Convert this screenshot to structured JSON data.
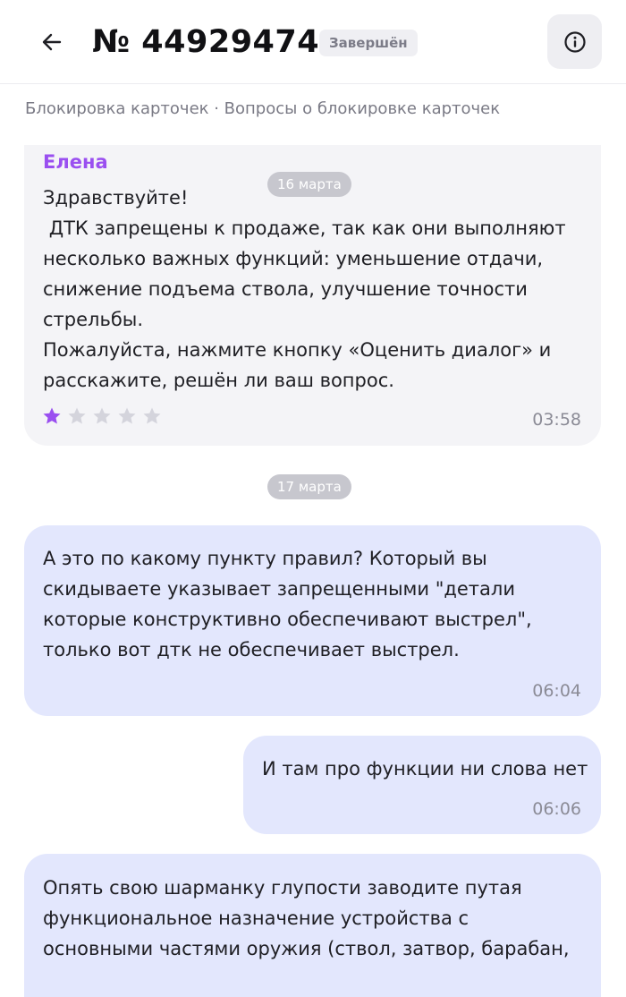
{
  "header": {
    "title": "№ 44929474",
    "status": "Завершён"
  },
  "breadcrumb": "Блокировка карточек · Вопросы о блокировке карточек",
  "dates": [
    "16 марта",
    "17 марта"
  ],
  "messages": [
    {
      "sender": "Елена",
      "text": "Здравствуйте!\n ДТК запрещены к продаже, так как они выполняют\nнесколько важных функций: уменьшение отдачи,\nснижение подъема ствола, улучшение точности\nстрельбы.\nПожалуйста, нажмите кнопку «Оценить диалог» и\nрасскажите, решён ли ваш вопрос.",
      "time": "03:58",
      "rating": 1,
      "rating_max": 5
    },
    {
      "text": "А это по какому пункту правил? Который вы\nскидываете указывает запрещенными \"детали\nкоторые конструктивно обеспечивают выстрел\",\nтолько вот дтк не обеспечивает выстрел.",
      "time": "06:04"
    },
    {
      "text": "И там про функции ни слова нет",
      "time": "06:06"
    },
    {
      "text": "Опять свою шарманку глупости заводите путая\nфункциональное назначение устройства с\nосновными частями оружия (ствол, затвор, барабан,"
    }
  ],
  "colors": {
    "accent": "#9a4ff0",
    "user_bubble": "#e3e7fd",
    "operator_bubble": "#f4f4f7",
    "star_empty": "#d4d4dc"
  },
  "icons": {
    "back": "arrow-left",
    "info": "info-circle",
    "star": "star"
  }
}
